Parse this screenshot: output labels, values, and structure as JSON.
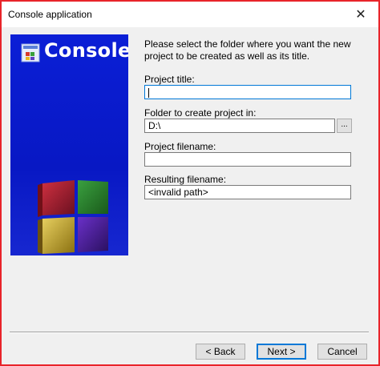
{
  "window": {
    "title": "Console application"
  },
  "banner": {
    "title": "Console"
  },
  "intro": "Please select the folder where you want the new project to be created as well as its title.",
  "fields": {
    "project_title": {
      "label": "Project title:",
      "value": ""
    },
    "folder": {
      "label": "Folder to create project in:",
      "value": "D:\\",
      "browse_label": "..."
    },
    "project_filename": {
      "label": "Project filename:",
      "value": ""
    },
    "resulting_filename": {
      "label": "Resulting filename:",
      "value": "<invalid path>"
    }
  },
  "buttons": {
    "back": "< Back",
    "next": "Next >",
    "cancel": "Cancel"
  },
  "icons": {
    "close": "close-icon",
    "logo": "codeblocks-logo-icon",
    "cubes": "codeblocks-cubes-icon"
  },
  "colors": {
    "banner": "#0b1fd6",
    "accent": "#0078d7",
    "frame": "#e8242a"
  }
}
